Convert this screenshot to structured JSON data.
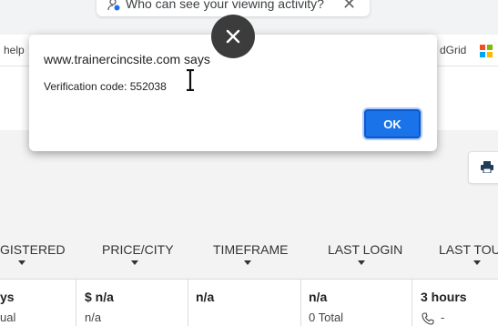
{
  "privacy_prompt": {
    "text": "Who can see your viewing activity?",
    "close_glyph": "✕"
  },
  "bookmarks": {
    "left_label": "help",
    "right_label": "dGrid"
  },
  "dialog": {
    "origin": "www.trainercincsite.com says",
    "message": "Verification code: 552038",
    "ok_label": "OK"
  },
  "overlay_close_glyph": "✕",
  "table": {
    "headers": [
      "GISTERED",
      "PRICE/CITY",
      "TIMEFRAME",
      "LAST LOGIN",
      "LAST TOUC"
    ],
    "row": [
      {
        "main": "ys",
        "sub": "ual"
      },
      {
        "main": "$ n/a",
        "sub": "n/a"
      },
      {
        "main": "n/a",
        "sub": ""
      },
      {
        "main": "n/a",
        "sub": "0 Total"
      },
      {
        "main": "3 hours",
        "sub": "-"
      }
    ]
  },
  "icons": {
    "privacy": "person-privacy-icon",
    "print": "print-icon",
    "phone": "phone-icon",
    "microsoft": "microsoft-logo-icon",
    "cursor": "text-cursor-icon"
  },
  "colors": {
    "ok_button": "#1a73e8",
    "overlay_close": "#3c3c3c",
    "ms_red": "#f25022",
    "ms_green": "#7fba00",
    "ms_blue": "#00a4ef",
    "ms_yellow": "#ffb900"
  }
}
